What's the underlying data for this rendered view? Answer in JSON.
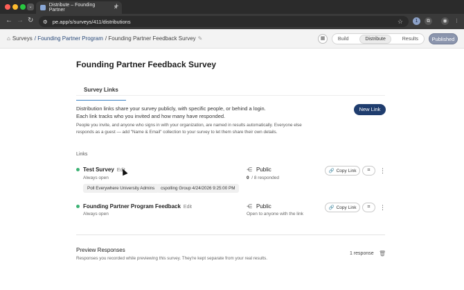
{
  "browser": {
    "tab_title": "Distribute – Founding Partner",
    "tab_close": "✕",
    "new_tab": "+",
    "url": "pe.app/s/surveys/411/distributions",
    "colors": {
      "red": "#ff5f57",
      "yellow": "#febc2e",
      "green": "#28c840"
    }
  },
  "header": {
    "breadcrumb": {
      "root": "Surveys",
      "program": "/ Founding Partner Program",
      "survey": "/ Founding Partner Feedback Survey"
    },
    "modes": [
      "Build",
      "Distribute",
      "Results"
    ],
    "active_mode": "Distribute",
    "status": "Published"
  },
  "page": {
    "title": "Founding Partner Feedback Survey",
    "tab": "Survey Links",
    "intro_line1": "Distribution links share your survey publicly, with specific people, or behind a login.",
    "intro_line2": "Each link tracks who you invited and how many have responded.",
    "intro_note": "People you invite, and anyone who signs in with your organization, are named in results automatically. Everyone else responds as a guest — add \"Name & Email\" collection to your survey to let them share their own details.",
    "new_link": "New Link",
    "links_label": "Links"
  },
  "links": [
    {
      "name": "Test Survey",
      "edit": "Edit",
      "schedule": "Always open",
      "visibility": "Public",
      "responded_count": "0",
      "responded_rest": "/ 8 responded",
      "copy": "Copy Link",
      "chips": [
        "Poll Everywhere University Admins",
        "cspolling Group 4/24/2026 9:25:00 PM"
      ]
    },
    {
      "name": "Founding Partner Program Feedback",
      "edit": "Edit",
      "schedule": "Always open",
      "visibility": "Public",
      "visibility_note": "Open to anyone with the link",
      "copy": "Copy Link"
    }
  ],
  "preview": {
    "title": "Preview Responses",
    "subtitle": "Responses you recorded while previewing this survey. They're kept separate from your real results.",
    "count": "1 response"
  }
}
